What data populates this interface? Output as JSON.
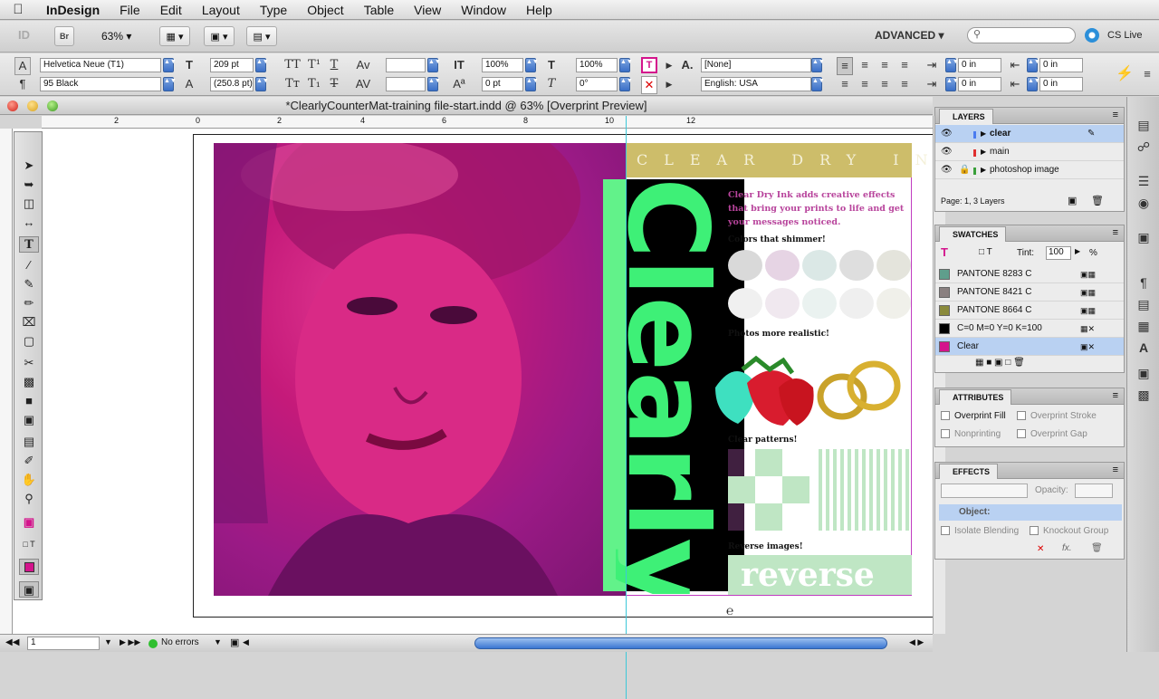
{
  "menubar": {
    "app_name": "InDesign",
    "items": [
      "File",
      "Edit",
      "Layout",
      "Type",
      "Object",
      "Table",
      "View",
      "Window",
      "Help"
    ]
  },
  "appbar": {
    "bridge": "Br",
    "zoom": "63%",
    "workspace": "ADVANCED",
    "cs_live": "CS Live"
  },
  "control": {
    "font_family": "Helvetica Neue (T1)",
    "font_style": "95 Black",
    "font_size": "209 pt",
    "leading": "(250.8 pt)",
    "vscale": "100%",
    "baseline": "0 pt",
    "hscale": "100%",
    "skew": "0°",
    "char_style": "[None]",
    "language": "English: USA",
    "indent_left": "0 in",
    "indent_first": "0 in",
    "indent_right": "0 in",
    "indent_last": "0 in"
  },
  "document": {
    "title": "*ClearlyCounterMat-training file-start.indd @ 63% [Overprint Preview]",
    "ruler_marks": [
      "2",
      "0",
      "2",
      "4",
      "6",
      "8",
      "10",
      "12"
    ],
    "band_text": "CLEAR DRY INK",
    "big_word": "Clearly",
    "intro": "Clear Dry Ink adds creative effects that bring your prints to life and get your messages noticed.",
    "sec1": "Colors that shimmer!",
    "sec2": "Photos more realistic!",
    "sec3": "Clear patterns!",
    "sec4": "Reverse images!",
    "reverse_word": "reverse",
    "colors": {
      "magenta": "#c51a7a",
      "green": "#3ef077",
      "gold": "#cdbd6a"
    }
  },
  "status": {
    "page": "1",
    "errors": "No errors"
  },
  "layers": {
    "tab": "LAYERS",
    "items": [
      {
        "name": "clear",
        "color": "#4a7cf0"
      },
      {
        "name": "main",
        "color": "#e03030"
      },
      {
        "name": "photoshop image",
        "color": "#3aa03a"
      }
    ],
    "footer": "Page: 1, 3 Layers"
  },
  "swatches": {
    "tab": "SWATCHES",
    "tint_label": "Tint:",
    "tint_value": "100",
    "pct": "%",
    "items": [
      {
        "name": "PANTONE 8283 C",
        "color": "#5f9e8c"
      },
      {
        "name": "PANTONE 8421 C",
        "color": "#8a8080"
      },
      {
        "name": "PANTONE 8664 C",
        "color": "#8a8a3c"
      },
      {
        "name": "C=0 M=0 Y=0 K=100",
        "color": "#000000"
      },
      {
        "name": "Clear",
        "color": "#d4148c"
      }
    ]
  },
  "attributes": {
    "tab": "ATTRIBUTES",
    "overprint_fill": "Overprint Fill",
    "overprint_stroke": "Overprint Stroke",
    "nonprinting": "Nonprinting",
    "overprint_gap": "Overprint Gap"
  },
  "effects": {
    "tab": "EFFECTS",
    "opacity_label": "Opacity:",
    "object": "Object:",
    "isolate": "Isolate Blending",
    "knockout": "Knockout Group",
    "fx": "fx."
  }
}
